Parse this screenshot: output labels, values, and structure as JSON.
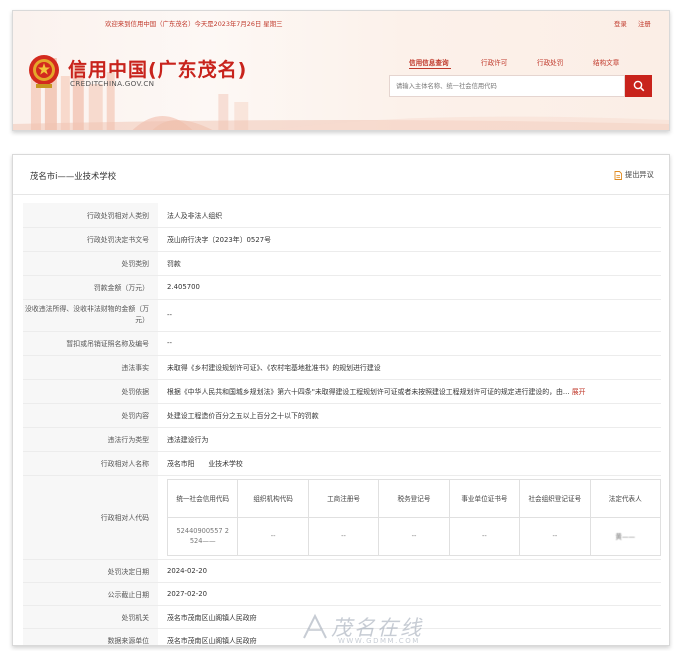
{
  "header": {
    "welcome": "欢迎来到信用中国（广东茂名）今天是2023年7月26日 星期三",
    "login": "登录",
    "register": "注册",
    "brand_title": "信用中国(广东茂名)",
    "brand_url": "CREDITCHINA.GOV.CN",
    "nav": [
      {
        "label": "信用信息查询",
        "active": true
      },
      {
        "label": "行政许可",
        "active": false
      },
      {
        "label": "行政处罚",
        "active": false
      },
      {
        "label": "结构文章",
        "active": false
      }
    ],
    "search_placeholder": "请输入主体名称、统一社会信用代码",
    "brand_color": "#c8231c"
  },
  "card": {
    "title": "茂名市i——业技术学校",
    "objection": "提出异议",
    "rows": [
      {
        "label": "行政处罚相对人类别",
        "value": "法人及非法人组织"
      },
      {
        "label": "行政处罚决定书文号",
        "value": "茂山府行决字〔2023年〕0527号"
      },
      {
        "label": "处罚类别",
        "value": "罚款"
      },
      {
        "label": "罚款金额（万元）",
        "value": "2.405700"
      },
      {
        "label": "没收违法所得、没收非法财物的金额（万元）",
        "value": "--"
      },
      {
        "label": "暂扣或吊销证照名称及编号",
        "value": "--"
      },
      {
        "label": "违法事实",
        "value": "未取得《乡村建设规划许可证》、《农村宅基地批准书》的规划进行建设"
      },
      {
        "label": "处罚依据",
        "value": "根据《中华人民共和国城乡规划法》第六十四条\"未取得建设工程规划许可证或者未按照建设工程规划许可证的规定进行建设的，由...",
        "expand": "展开"
      },
      {
        "label": "处罚内容",
        "value": "处建设工程造价百分之五以上百分之十以下的罚款"
      },
      {
        "label": "违法行为类型",
        "value": "违法建设行为"
      },
      {
        "label": "行政相对人名称",
        "value": "茂名市阳　　业技术学校"
      }
    ],
    "code_label": "行政相对人代码",
    "code_headers": [
      "统一社会信用代码",
      "组织机构代码",
      "工商注册号",
      "税务登记号",
      "事业单位证书号",
      "社会组织登记证号",
      "法定代表人"
    ],
    "code_values": [
      "52440900557 2 524——",
      "--",
      "--",
      "--",
      "--",
      "--",
      "黄——"
    ],
    "rows_after": [
      {
        "label": "处罚决定日期",
        "value": "2024-02-20"
      },
      {
        "label": "公示截止日期",
        "value": "2027-02-20"
      },
      {
        "label": "处罚机关",
        "value": "茂名市茂南区山阁镇人民政府"
      },
      {
        "label": "数据来源单位",
        "value": "茂名市茂南区山阁镇人民政府"
      }
    ]
  },
  "watermark": {
    "text": "茂名在线",
    "url": "WWW.GDMM.COM"
  }
}
